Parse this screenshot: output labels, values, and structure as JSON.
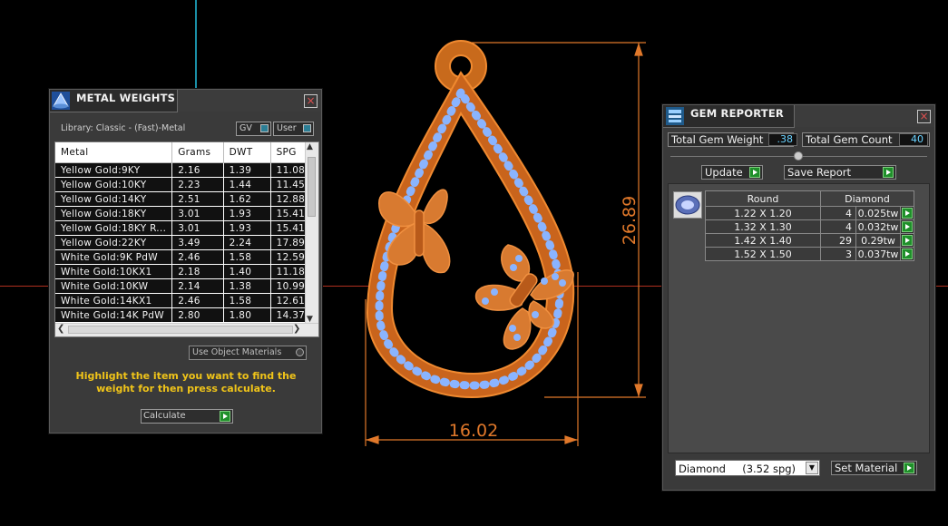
{
  "viewport": {
    "dim_height": "26.89",
    "dim_width": "16.02",
    "accent_orange": "#e0782a",
    "gem_blue": "#8ab4ff"
  },
  "metal_weights": {
    "title": "METAL WEIGHTS",
    "library_label": "Library: Classic - (Fast)-Metal",
    "toggle_gv": "GV",
    "toggle_user": "User",
    "columns": [
      "Metal",
      "Grams",
      "DWT",
      "SPG"
    ],
    "rows": [
      [
        "Yellow Gold:9KY",
        "2.16",
        "1.39",
        "11.08"
      ],
      [
        "Yellow Gold:10KY",
        "2.23",
        "1.44",
        "11.45"
      ],
      [
        "Yellow Gold:14KY",
        "2.51",
        "1.62",
        "12.88"
      ],
      [
        "Yellow Gold:18KY",
        "3.01",
        "1.93",
        "15.41"
      ],
      [
        "Yellow Gold:18KY R...",
        "3.01",
        "1.93",
        "15.41"
      ],
      [
        "Yellow Gold:22KY",
        "3.49",
        "2.24",
        "17.89"
      ],
      [
        "White Gold:9K PdW",
        "2.46",
        "1.58",
        "12.59"
      ],
      [
        "White Gold:10KX1",
        "2.18",
        "1.40",
        "11.18"
      ],
      [
        "White Gold:10KW",
        "2.14",
        "1.38",
        "10.99"
      ],
      [
        "White Gold:14KX1",
        "2.46",
        "1.58",
        "12.61"
      ],
      [
        "White Gold:14K PdW",
        "2.80",
        "1.80",
        "14.37"
      ]
    ],
    "use_object_materials": "Use Object Materials",
    "hint": "Highlight the item you want to find the weight for then press calculate.",
    "calculate_label": "Calculate"
  },
  "gem_reporter": {
    "title": "GEM REPORTER",
    "total_gem_weight_label": "Total Gem Weight",
    "total_gem_weight": ".38",
    "total_gem_count_label": "Total Gem Count",
    "total_gem_count": "40",
    "update_label": "Update",
    "save_report_label": "Save Report",
    "columns": [
      "Round",
      "Diamond"
    ],
    "rows": [
      [
        "1.22 X 1.20",
        "4",
        "0.025tw"
      ],
      [
        "1.32 X 1.30",
        "4",
        "0.032tw"
      ],
      [
        "1.42 X 1.40",
        "29",
        "0.29tw"
      ],
      [
        "1.52 X 1.50",
        "3",
        "0.037tw"
      ]
    ],
    "material_select": "Diamond     (3.52 spg)",
    "set_material_label": "Set Material"
  }
}
